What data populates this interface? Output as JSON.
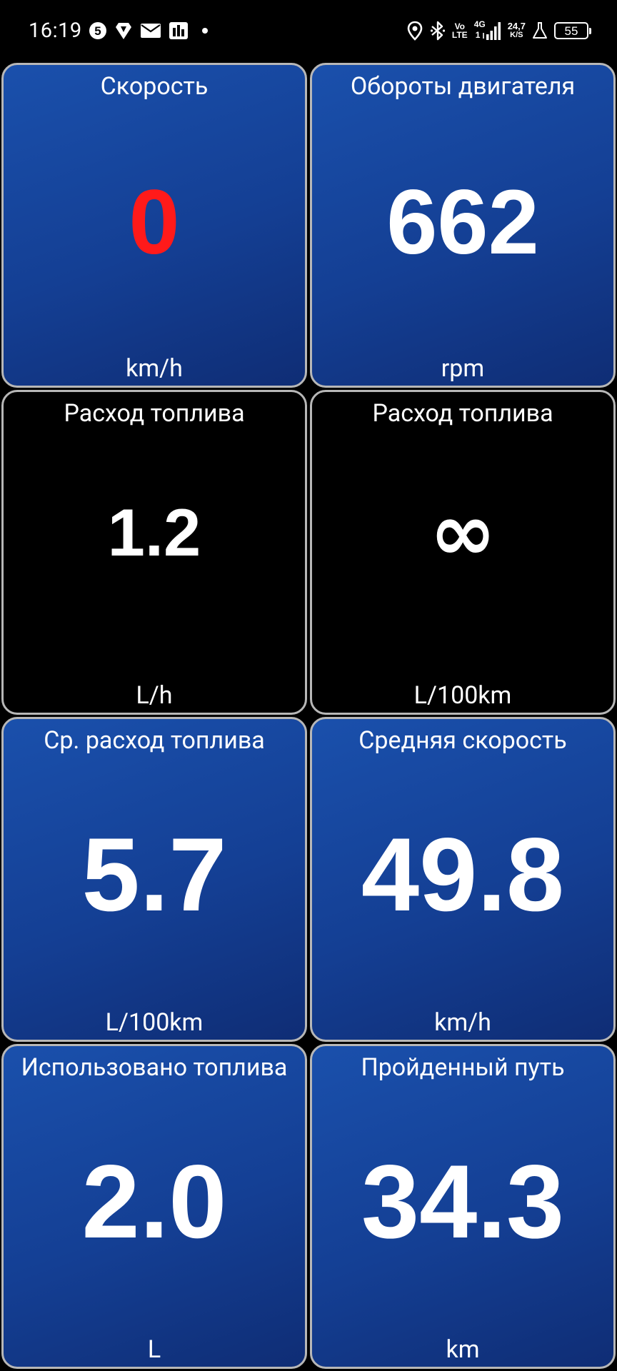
{
  "status_bar": {
    "time": "16:19",
    "notif_icons": [
      "five-circle-icon",
      "navigation-tag-icon",
      "mail-icon",
      "news-icon",
      "dot-icon"
    ],
    "five_label": "5",
    "volte_top": "Vo",
    "volte_bottom": "LTE",
    "network_label": "4G",
    "network_sub": "1",
    "net_speed_value": "24,7",
    "net_speed_unit": "K/S",
    "battery_level": "55"
  },
  "tiles": [
    {
      "title": "Скорость",
      "value": "0",
      "unit": "km/h",
      "value_color": "#ff1a1a",
      "background": "blue"
    },
    {
      "title": "Обороты двигателя",
      "value": "662",
      "unit": "rpm",
      "value_color": "#ffffff",
      "background": "blue"
    },
    {
      "title": "Расход топлива",
      "value": "1.2",
      "unit": "L/h",
      "value_color": "#ffffff",
      "background": "black"
    },
    {
      "title": "Расход топлива",
      "value": "∞",
      "unit": "L/100km",
      "value_color": "#ffffff",
      "background": "black"
    },
    {
      "title": "Ср. расход топлива",
      "value": "5.7",
      "unit": "L/100km",
      "value_color": "#ffffff",
      "background": "blue"
    },
    {
      "title": "Средняя скорость",
      "value": "49.8",
      "unit": "km/h",
      "value_color": "#ffffff",
      "background": "blue"
    },
    {
      "title": "Использовано топлива",
      "value": "2.0",
      "unit": "L",
      "value_color": "#ffffff",
      "background": "blue"
    },
    {
      "title": "Пройденный путь",
      "value": "34.3",
      "unit": "km",
      "value_color": "#ffffff",
      "background": "blue"
    }
  ],
  "colors": {
    "tile_blue": "#143f94",
    "tile_border": "#b7b7b7",
    "speed_value": "#ff1a1a"
  }
}
